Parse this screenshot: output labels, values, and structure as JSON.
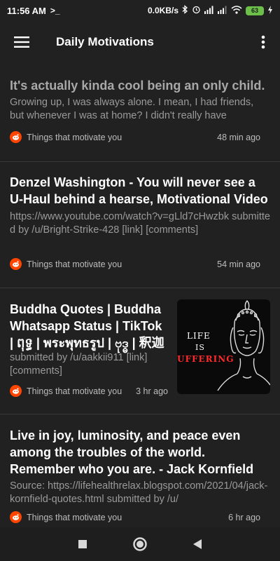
{
  "status_bar": {
    "time": "11:56 AM",
    "network_speed": "0.0KB/s",
    "battery": "63"
  },
  "toolbar": {
    "title": "Daily Motivations"
  },
  "posts": [
    {
      "title": "It's actually kinda cool being an only child.",
      "body": "Growing up, I was always alone. I mean, I had friends, but whenever I was at home? I didn't really have",
      "subreddit": "Things that motivate you",
      "time": "48 min ago"
    },
    {
      "title": "Denzel Washington - You will never see a U-Haul behind a hearse, Motivational Video",
      "body": "https://www.youtube.com/watch?v=gLld7cHwzbk submitted by /u/Bright-Strike-428 [link] [comments]",
      "subreddit": "Things that motivate you",
      "time": "54 min ago"
    },
    {
      "title": "Buddha Quotes | Buddha Whatsapp Status | TikTok | ពុទ្ធ | พระพุทธรูป | ဗုဒ္ဓ | 釈迦",
      "body": "submitted by /u/aakkii911 [link] [comments]",
      "subreddit": "Things that motivate you",
      "time": "3 hr ago",
      "thumbnail": {
        "line1": "LIFE",
        "line2": "IS",
        "line3": "UFFERING"
      }
    },
    {
      "title": "Live in joy, luminosity, and peace even among the troubles of the world. Remember who you are. - Jack Kornfield",
      "body": "Source: https://lifehealthrelax.blogspot.com/2021/04/jack-kornfield-quotes.html submitted by /u/",
      "subreddit": "Things that motivate you",
      "time": "6 hr ago"
    }
  ],
  "colors": {
    "background": "#212121",
    "subreddit_icon": "#ff4500",
    "battery": "#6cc04a"
  },
  "icons": {
    "menu": "hamburger-menu-icon",
    "more": "more-vert-icon",
    "subreddit": "reddit-icon",
    "nav_recents": "square-icon",
    "nav_home": "circle-icon",
    "nav_back": "triangle-back-icon"
  }
}
